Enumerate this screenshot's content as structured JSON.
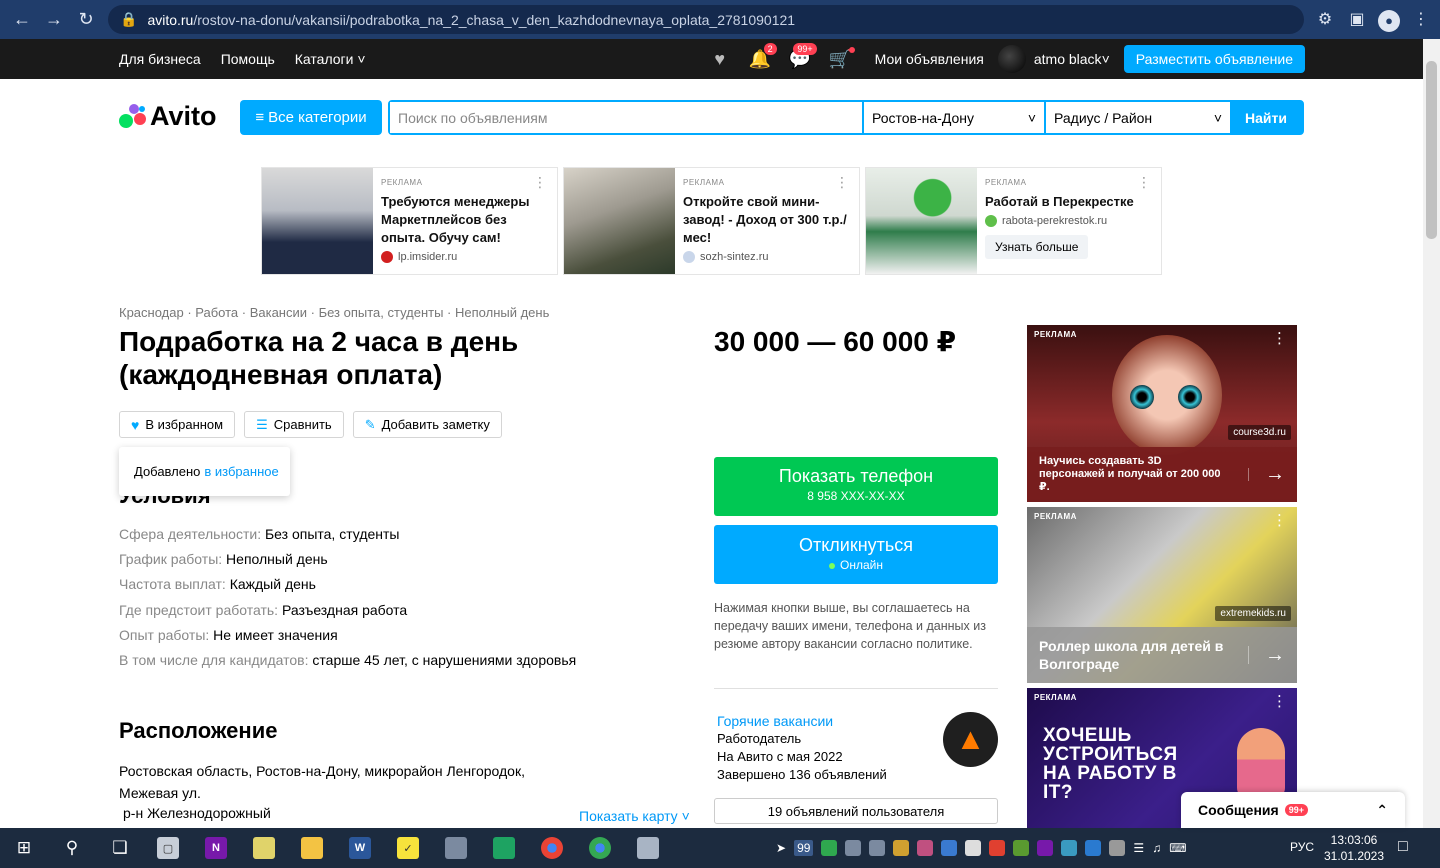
{
  "browser": {
    "url_host": "avito.ru",
    "url_path": "/rostov-na-donu/vakansii/podrabotka_na_2_chasa_v_den_kazhdodnevnaya_oplata_2781090121"
  },
  "topnav": {
    "for_business": "Для бизнеса",
    "help": "Помощь",
    "catalogs": "Каталоги",
    "notif_count": "2",
    "messages_count": "99+",
    "my_ads": "Мои объявления",
    "user_name": "atmo black",
    "post_ad": "Разместить объявление"
  },
  "header": {
    "logo": "Avito",
    "all_categories": "Все категории",
    "search_placeholder": "Поиск по объявлениям",
    "city": "Ростов-на-Дону",
    "radius": "Радиус / Район",
    "search_button": "Найти"
  },
  "ads": [
    {
      "label": "РЕКЛАМА",
      "title": "Требуются менеджеры Маркетплейсов без опыта. Обучу сам!",
      "source": "lp.imsider.ru"
    },
    {
      "label": "РЕКЛАМА",
      "title": "Откройте свой мини-завод! - Доход от 300 т.р./мес!",
      "source": "sozh-sintez.ru"
    },
    {
      "label": "РЕКЛАМА",
      "title": "Работай в Перекрестке",
      "source": "rabota-perekrestok.ru",
      "cta": "Узнать больше"
    }
  ],
  "listing": {
    "breadcrumbs": "Краснодар · Работа · Вакансии · Без опыта, студенты · Неполный день",
    "title": "Подработка на 2 часа в день (каждодневная оплата)",
    "favorite": "В избранном",
    "compare": "Сравнить",
    "add_note": "Добавить заметку",
    "tooltip_text": "Добавлено",
    "tooltip_link": "в избранное",
    "conditions_title": "Условия",
    "conditions": [
      {
        "k": "Сфера деятельности:",
        "v": "Без опыта, студенты"
      },
      {
        "k": "График работы:",
        "v": "Неполный день"
      },
      {
        "k": "Частота выплат:",
        "v": "Каждый день"
      },
      {
        "k": "Где предстоит работать:",
        "v": "Разъездная работа"
      },
      {
        "k": "Опыт работы:",
        "v": "Не имеет значения"
      },
      {
        "k": "В том числе для кандидатов:",
        "v": "старше 45 лет, с нарушениями здоровья"
      }
    ],
    "location_title": "Расположение",
    "address": "Ростовская область, Ростов-на-Дону, микрорайон Ленгородок, Межевая ул.",
    "district": "р-н Железнодорожный",
    "show_map": "Показать карту"
  },
  "sidebar": {
    "price": "30 000 — 60 000 ₽",
    "show_phone": "Показать телефон",
    "phone_masked": "8 958 XXX-XX-XX",
    "respond": "Откликнуться",
    "online": "Онлайн",
    "consent": "Нажимая кнопки выше, вы соглашаетесь на передачу ваших имени, телефона и данных из резюме автору вакансии согласно политике.",
    "seller_name": "Горячие вакансии",
    "seller_type": "Работодатель",
    "seller_since": "На Авито с мая 2022",
    "seller_done": "Завершено 136 объявлений",
    "all_ads": "19 объявлений пользователя"
  },
  "side_ads": [
    {
      "label": "РЕКЛАМА",
      "source": "course3d.ru",
      "text": "Научись создавать 3D персонажей и получай от 200 000 ₽."
    },
    {
      "label": "РЕКЛАМА",
      "source": "extremekids.ru",
      "text": "Роллер школа для детей в Волгограде"
    },
    {
      "label": "РЕКЛАМА",
      "text": "ХОЧЕШЬ УСТРОИТЬСЯ НА РАБОТУ В IT?"
    }
  ],
  "messages_widget": {
    "label": "Сообщения",
    "count": "99+"
  },
  "taskbar": {
    "tray_count": "99",
    "lang": "РУС",
    "time": "13:03:06",
    "date": "31.01.2023"
  }
}
